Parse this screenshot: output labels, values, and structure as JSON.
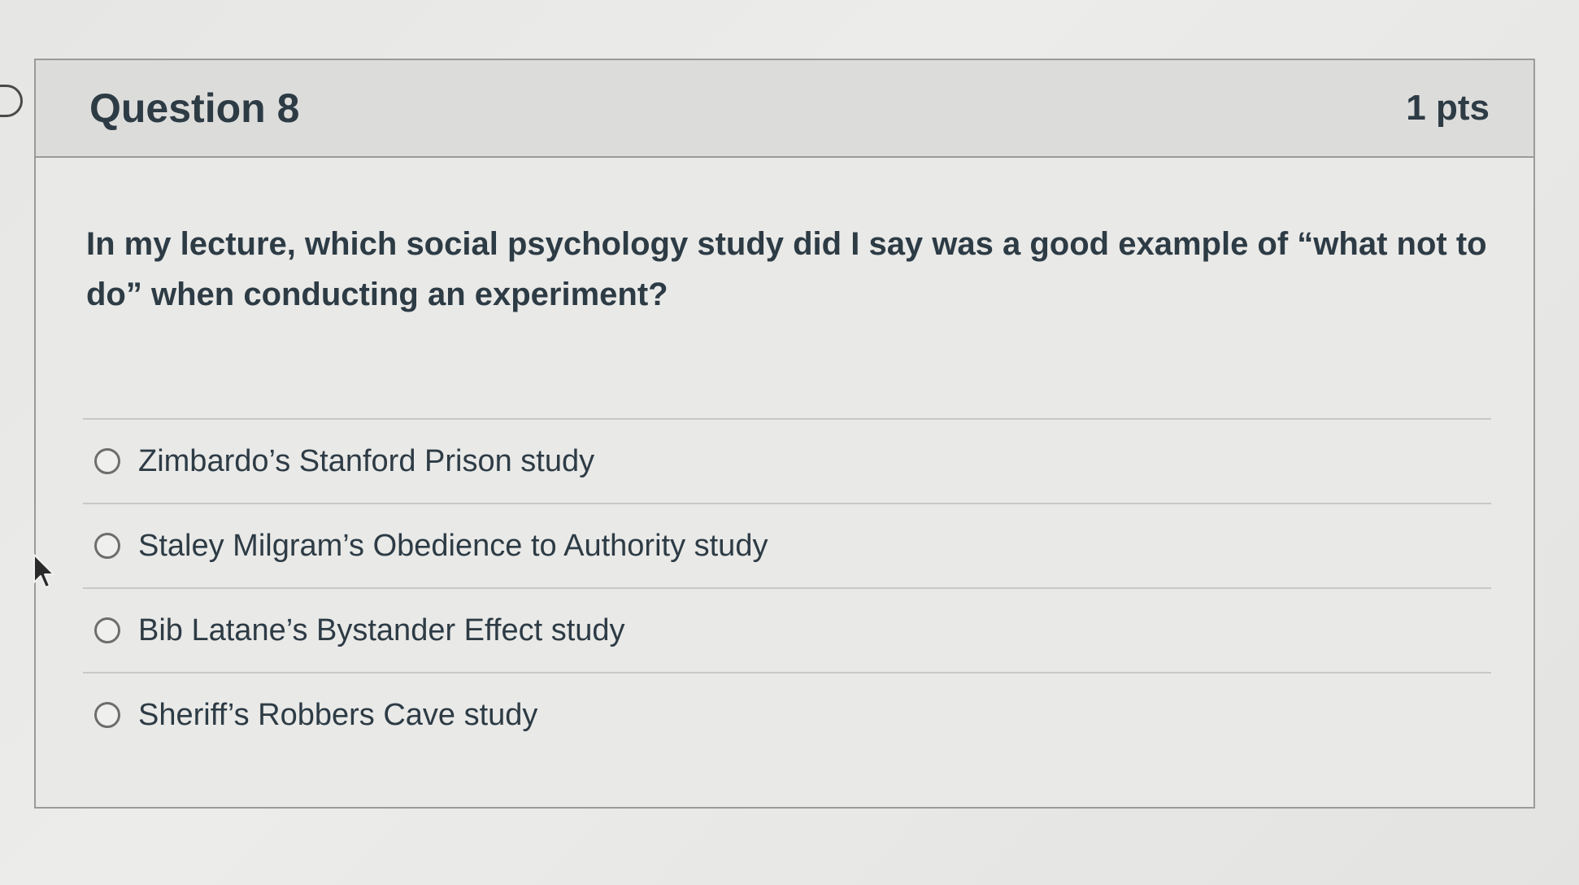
{
  "question": {
    "title": "Question 8",
    "points": "1 pts",
    "text": "In my lecture, which social psychology study did I say was a good example of “what not to do” when conducting an experiment?"
  },
  "answers": [
    {
      "label": "Zimbardo’s Stanford Prison study",
      "selected": false
    },
    {
      "label": "Staley Milgram’s Obedience to Authority study",
      "selected": false
    },
    {
      "label": "Bib Latane’s Bystander Effect study",
      "selected": false
    },
    {
      "label": "Sheriff’s Robbers Cave study",
      "selected": false
    }
  ],
  "icons": {
    "bookmark": "bookmark-icon",
    "cursor": "mouse-pointer-icon",
    "radio": "radio-button-icon"
  },
  "colors": {
    "text": "#2d3b45",
    "border": "#9a9a98",
    "header_bg": "#dcdcda"
  }
}
